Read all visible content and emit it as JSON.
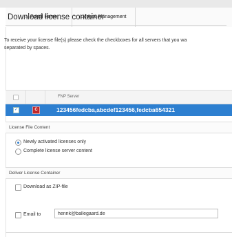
{
  "nav": {
    "home_label": "Portal Home",
    "license_label": "License Management"
  },
  "page": {
    "title": "Download license container",
    "intro_line1": "To receive your license file(s) please check the checkboxes for all servers that you wa",
    "intro_line2": "separated by spaces."
  },
  "server_table": {
    "column_header": "FNP Server",
    "rows": [
      {
        "servers": "123456fedcba,abcdef123456,fedcba654321",
        "checked": true,
        "selected": true
      }
    ]
  },
  "license_content": {
    "section_label": "License File Content",
    "options": [
      {
        "label": "Newly activated licenses only",
        "selected": true
      },
      {
        "label": "Complete license server content",
        "selected": false
      }
    ]
  },
  "deliver": {
    "section_label": "Deliver License Container",
    "zip_label": "Download as ZIP-file",
    "zip_checked": false,
    "email_label": "Email to",
    "email_checked": false,
    "email_value": "henrik@ballegaard.de"
  },
  "icons": {
    "home": "home-icon",
    "server": "server-icon"
  },
  "colors": {
    "selection": "#2d7fd0",
    "server_icon": "#c0262a"
  }
}
